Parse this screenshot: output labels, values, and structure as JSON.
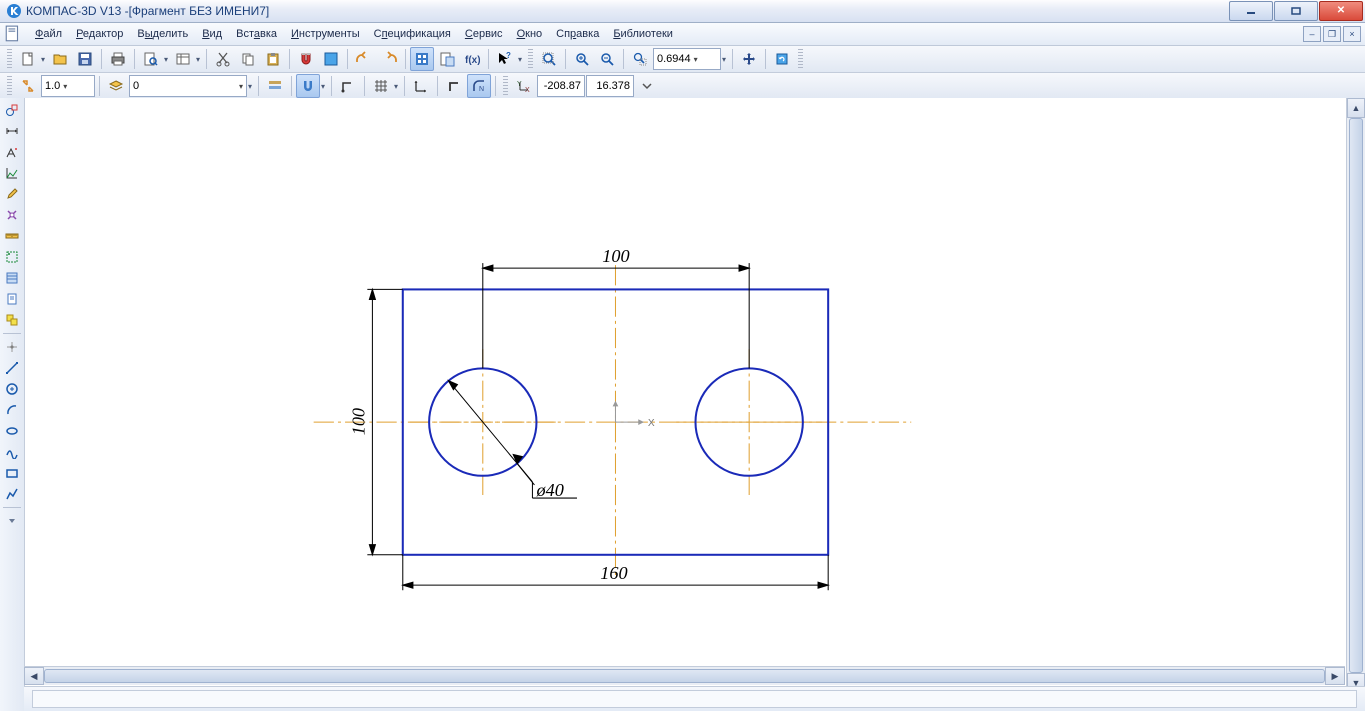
{
  "title": {
    "app": "КОМПАС-3D V13 - ",
    "doc": "[Фрагмент БЕЗ ИМЕНИ7]"
  },
  "menu": {
    "file": "Файл",
    "edit": "Редактор",
    "select": "Выделить",
    "view": "Вид",
    "insert": "Вставка",
    "tools": "Инструменты",
    "spec": "Спецификация",
    "service": "Сервис",
    "window": "Окно",
    "help": "Справка",
    "libs": "Библиотеки"
  },
  "toolbar2": {
    "zoom": "0.6944"
  },
  "toolbar3": {
    "scale": "1.0",
    "layer": "0",
    "coord_x": "-208.87",
    "coord_y": "16.378"
  },
  "drawing": {
    "dim_top": "100",
    "dim_left": "100",
    "dim_bottom": "160",
    "dim_diam": "ø40",
    "axis_x": "X"
  }
}
